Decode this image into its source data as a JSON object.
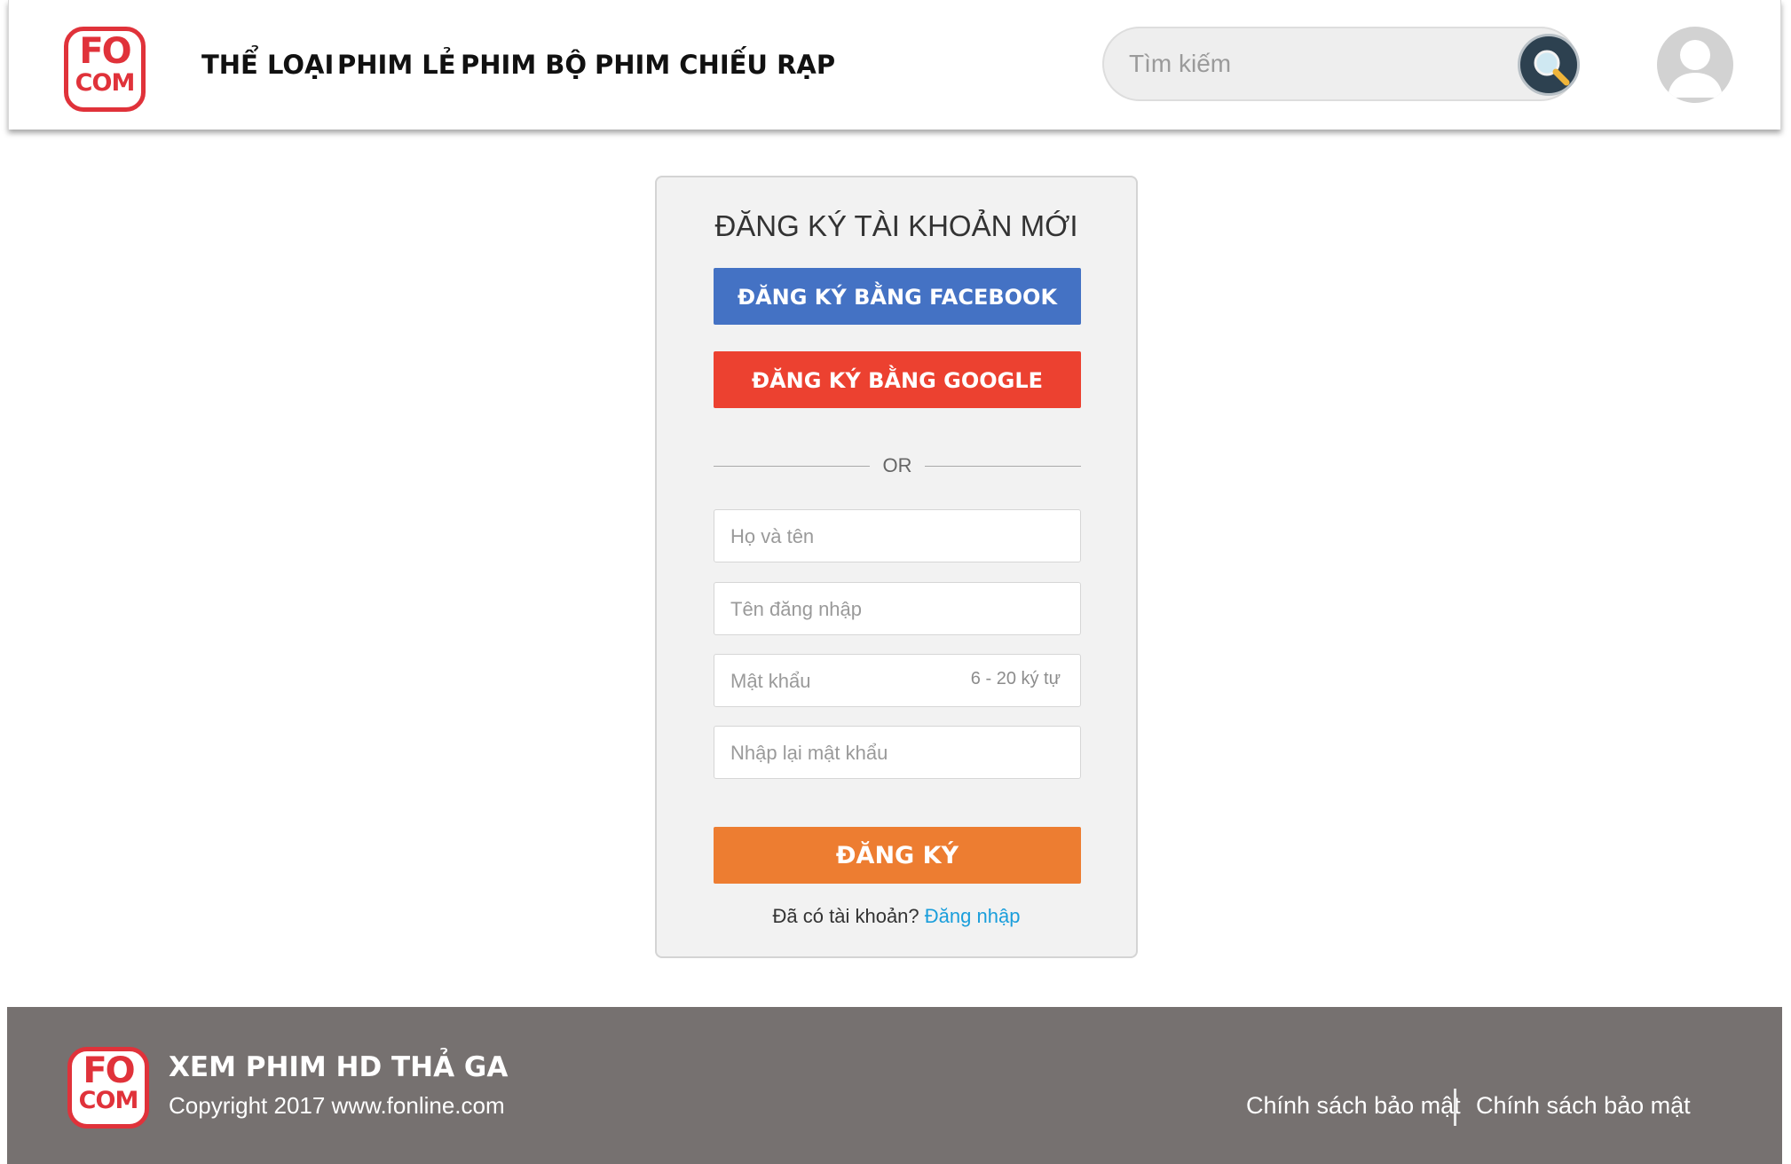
{
  "header": {
    "logo": {
      "top": "FO",
      "bottom": "COM"
    },
    "nav": [
      "THỂ LOẠI",
      "PHIM LẺ",
      "PHIM BỘ",
      "PHIM CHIẾU RẠP"
    ],
    "search": {
      "placeholder": "Tìm kiếm",
      "icon": "magnifier-icon"
    },
    "avatar": {
      "icon": "user-avatar-icon"
    }
  },
  "signup": {
    "title": "ĐĂNG KÝ TÀI KHOẢN MỚI",
    "facebook_label": "ĐĂNG KÝ BẰNG FACEBOOK",
    "google_label": "ĐĂNG KÝ BẰNG GOOGLE",
    "or_label": "OR",
    "fields": {
      "fullname_placeholder": "Họ và tên",
      "username_placeholder": "Tên đăng nhập",
      "password_placeholder": "Mật khẩu",
      "password_hint": "6 - 20 ký tự",
      "confirm_placeholder": "Nhập lại mật khẩu"
    },
    "submit_label": "ĐĂNG KÝ",
    "login_prompt": "Đã có tài khoản? ",
    "login_link": "Đăng nhập"
  },
  "footer": {
    "logo": {
      "top": "FO",
      "bottom": "COM"
    },
    "title": "XEM PHIM HD THẢ GA",
    "copyright": "Copyright 2017 www.fonline.com",
    "links": [
      "Chính sách bảo mật",
      "Chính sách bảo mật"
    ]
  },
  "colors": {
    "brand_red": "#e0323a",
    "facebook": "#4472c4",
    "google": "#ec4130",
    "submit": "#ed7d31",
    "link": "#1a9edb",
    "footer_bg": "#767170"
  }
}
